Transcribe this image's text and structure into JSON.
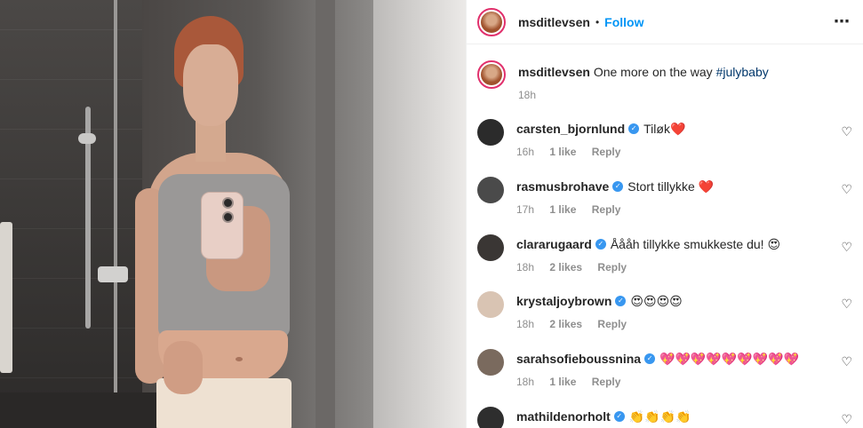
{
  "post": {
    "username": "msditlevsen",
    "dot": "•",
    "follow_label": "Follow",
    "more_icon": "more-options-icon",
    "caption_text": "One more on the way",
    "caption_hashtag": "#julybaby",
    "caption_time": "18h"
  },
  "comments": [
    {
      "username": "carsten_bjornlund",
      "text": "Tiløk❤️",
      "time": "16h",
      "likes": "1 like",
      "reply": "Reply",
      "avatar_color": "#2b2b2b"
    },
    {
      "username": "rasmusbrohave",
      "text": "Stort tillykke ❤️",
      "time": "17h",
      "likes": "1 like",
      "reply": "Reply",
      "avatar_color": "#4a4a4a"
    },
    {
      "username": "clararugaard",
      "text": "Åååh tillykke smukkeste du! 😍",
      "time": "18h",
      "likes": "2 likes",
      "reply": "Reply",
      "avatar_color": "#3a3634"
    },
    {
      "username": "krystaljoybrown",
      "text": "😍😍😍😍",
      "time": "18h",
      "likes": "2 likes",
      "reply": "Reply",
      "avatar_color": "#d9c4b3"
    },
    {
      "username": "sarahsofieboussnina",
      "text": "💖💖💖💖💖💖💖💖💖",
      "time": "18h",
      "likes": "1 like",
      "reply": "Reply",
      "avatar_color": "#7a6a5e"
    },
    {
      "username": "mathildenorholt",
      "text": "👏👏👏👏",
      "time": "",
      "likes": "",
      "reply": "",
      "avatar_color": "#2e2e2e"
    }
  ],
  "icons": {
    "heart": "heart-outline-icon",
    "verified": "verified-badge-icon"
  }
}
